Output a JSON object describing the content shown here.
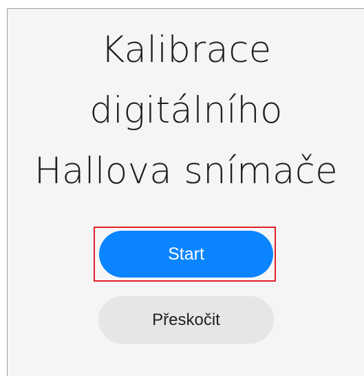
{
  "screen": {
    "title_lines": [
      "Kalibrace",
      "digitálního",
      "Hallova snímače"
    ]
  },
  "buttons": {
    "start_label": "Start",
    "skip_label": "Přeskočit"
  },
  "colors": {
    "background": "#f5f5f5",
    "primary_button": "#0a84ff",
    "secondary_button": "#e6e6e6",
    "highlight": "#e0202a",
    "text": "#1f1f1f"
  }
}
